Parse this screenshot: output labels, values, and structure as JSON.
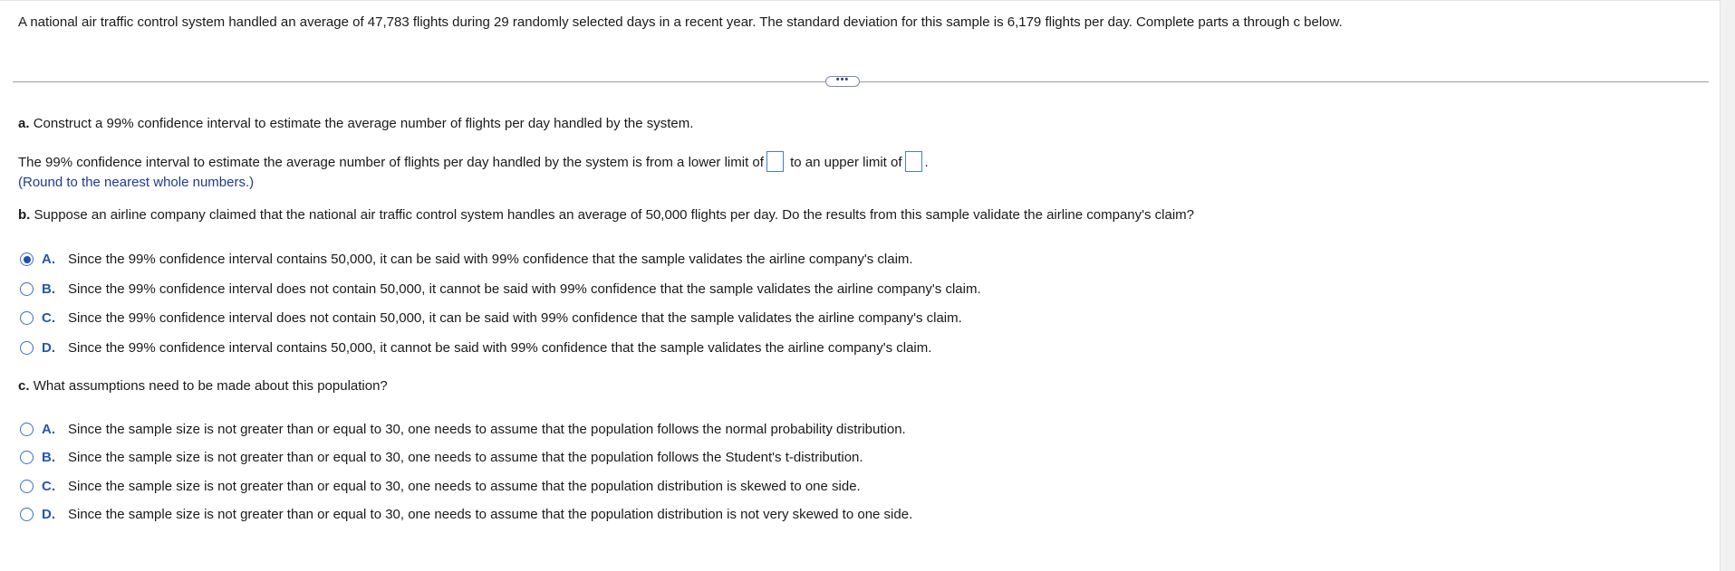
{
  "intro": "A national air traffic control system handled an average of 47,783 flights during 29 randomly selected days in a recent year. The standard deviation for this sample is 6,179 flights per day. Complete parts a through c below.",
  "more_button_glyph": "•••",
  "part_a": {
    "label": "a.",
    "question": "Construct a 99% confidence interval to estimate the average number of flights per day handled by the system.",
    "answer_prefix": "The 99% confidence interval to estimate the average number of flights per day handled by the system is from a lower limit of",
    "answer_middle": "to an upper limit of",
    "answer_suffix": ".",
    "lower_limit_value": "",
    "upper_limit_value": "",
    "hint": "(Round to the nearest whole numbers.)"
  },
  "part_b": {
    "label": "b.",
    "question": "Suppose an airline company claimed that the national air traffic control system handles an average of 50,000 flights per day. Do the results from this sample validate the airline company's claim?",
    "selected": "A",
    "options": [
      {
        "letter": "A.",
        "text": "Since the 99% confidence interval contains 50,000, it can be said with 99% confidence that the sample validates the airline company's claim."
      },
      {
        "letter": "B.",
        "text": "Since the 99% confidence interval does not contain 50,000, it cannot be said with 99% confidence that the sample validates the airline company's claim."
      },
      {
        "letter": "C.",
        "text": "Since the 99% confidence interval does not contain 50,000, it can be said with 99% confidence that the sample validates the airline company's claim."
      },
      {
        "letter": "D.",
        "text": "Since the 99% confidence interval contains 50,000, it cannot be said with 99% confidence that the sample validates the airline company's claim."
      }
    ]
  },
  "part_c": {
    "label": "c.",
    "question": "What assumptions need to be made about this population?",
    "selected": "",
    "options": [
      {
        "letter": "A.",
        "text": "Since the sample size is not greater than or equal to 30, one needs to assume that the population follows the normal probability distribution."
      },
      {
        "letter": "B.",
        "text": "Since the sample size is not greater than or equal to 30, one needs to assume that the population follows the Student's t-distribution."
      },
      {
        "letter": "C.",
        "text": "Since the sample size is not greater than or equal to 30, one needs to assume that the population distribution is skewed to one side."
      },
      {
        "letter": "D.",
        "text": "Since the sample size is not greater than or equal to 30, one needs to assume that the population distribution is not very skewed to one side."
      }
    ]
  },
  "colors": {
    "accent": "#2456b4",
    "radio_border": "#3a6fc4",
    "input_border": "#4a7bd0",
    "hint": "#1f3b8f"
  }
}
